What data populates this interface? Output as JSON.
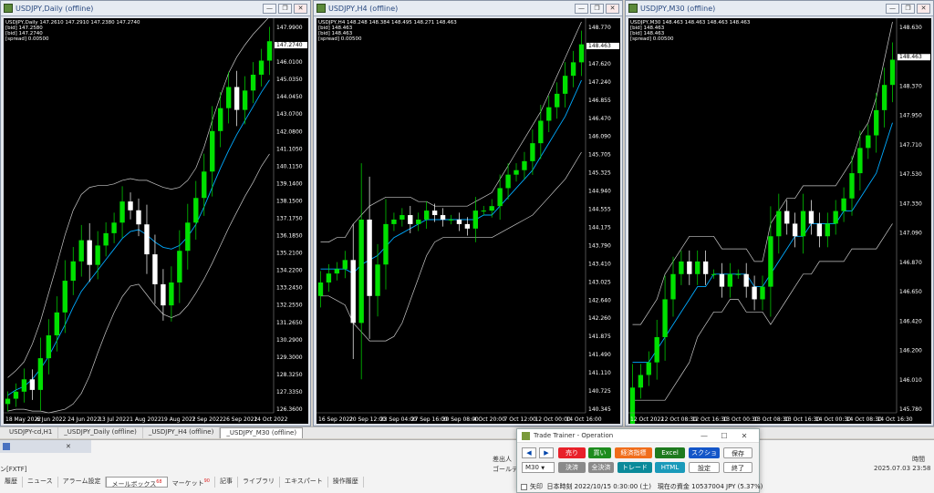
{
  "charts": [
    {
      "title": "USDJPY,Daily (offline)",
      "info1": "USDJPY,Daily  147.2610 147.2910 147.2380 147.2740",
      "info2": "[bid] 147.2580",
      "info3": "[bid] 147.2740",
      "info4": "[spread] 0.00500",
      "last_price": "147.2740",
      "yticks": [
        "147.9900",
        "147.2740",
        "146.0100",
        "145.0350",
        "144.0450",
        "143.0700",
        "142.0800",
        "141.1050",
        "140.1150",
        "139.1400",
        "138.1500",
        "137.1750",
        "136.1850",
        "135.2100",
        "134.2200",
        "133.2450",
        "132.2550",
        "131.2650",
        "130.2900",
        "129.3000",
        "128.3250",
        "127.3350",
        "126.3600"
      ],
      "xticks": [
        "18 May 2022",
        "6 Jun 2022",
        "24 Jun 2022",
        "13 Jul 2022",
        "1 Aug 2022",
        "19 Aug 2022",
        "7 Sep 2022",
        "26 Sep 2022",
        "14 Oct 2022"
      ],
      "series": {
        "close": [
          126.9,
          127.3,
          128.0,
          127.4,
          129.2,
          130.5,
          131.8,
          133.6,
          134.7,
          135.9,
          134.5,
          135.6,
          136.3,
          136.9,
          138.1,
          137.6,
          136.8,
          135.1,
          133.4,
          132.2,
          133.5,
          135.3,
          136.9,
          138.3,
          139.8,
          142.1,
          143.4,
          144.6,
          143.3,
          144.4,
          145.3,
          146.1,
          147.2
        ],
        "mid": [
          127.1,
          127.4,
          127.6,
          128.0,
          128.6,
          129.3,
          130.2,
          131.1,
          132.1,
          133.0,
          133.6,
          134.2,
          134.8,
          135.4,
          136.0,
          136.4,
          136.5,
          136.2,
          135.8,
          135.5,
          135.4,
          135.6,
          136.1,
          136.8,
          137.8,
          138.9,
          140.0,
          141.0,
          141.9,
          142.7,
          143.5,
          144.3,
          145.0
        ],
        "upper": [
          128.1,
          128.5,
          129.0,
          130.0,
          131.3,
          132.9,
          134.5,
          136.2,
          137.6,
          138.5,
          138.9,
          139.0,
          139.0,
          139.1,
          139.3,
          139.4,
          139.3,
          139.3,
          139.1,
          138.9,
          138.8,
          138.9,
          139.3,
          140.0,
          141.2,
          142.7,
          144.1,
          145.4,
          146.3,
          147.0,
          147.6,
          148.1,
          148.6
        ],
        "lower": [
          126.2,
          126.3,
          126.3,
          126.2,
          126.2,
          126.1,
          126.2,
          126.3,
          126.6,
          127.2,
          128.2,
          129.5,
          130.7,
          131.8,
          132.7,
          133.3,
          133.4,
          132.8,
          132.2,
          131.7,
          131.5,
          131.7,
          132.2,
          132.9,
          133.7,
          134.6,
          135.6,
          136.6,
          137.5,
          138.4,
          139.2,
          140.1,
          140.8
        ]
      },
      "ymin": 126.1,
      "ymax": 148.3
    },
    {
      "title": "USDJPY,H4 (offline)",
      "info1": "USDJPY,H4  148.248 148.384 148.495 148.271 148.463",
      "info2": "[bid] 148.463",
      "info3": "[bid] 148.463",
      "info4": "[spread] 0.00500",
      "last_price": "148.463",
      "yticks": [
        "148.770",
        "148.463",
        "147.620",
        "147.240",
        "146.855",
        "146.470",
        "146.090",
        "145.705",
        "145.325",
        "144.940",
        "144.555",
        "144.175",
        "143.790",
        "143.410",
        "143.025",
        "142.640",
        "142.260",
        "141.875",
        "141.490",
        "141.110",
        "140.725",
        "140.345"
      ],
      "xticks": [
        "16 Sep 2022",
        "20 Sep 12:00",
        "23 Sep 04:00",
        "27 Sep 16:00",
        "30 Sep 08:00",
        "4 Oct 20:00",
        "7 Oct 12:00",
        "12 Oct 00:00",
        "14 Oct 16:00"
      ],
      "series": {
        "close": [
          143.2,
          143.4,
          143.5,
          143.7,
          142.3,
          144.6,
          142.9,
          143.6,
          144.5,
          144.6,
          144.7,
          144.5,
          144.6,
          144.8,
          144.7,
          144.6,
          144.6,
          144.5,
          144.4,
          144.8,
          144.8,
          144.9,
          145.3,
          145.6,
          145.7,
          145.9,
          146.3,
          146.8,
          147.1,
          147.4,
          147.8,
          148.1,
          148.5
        ],
        "mid": [
          143.5,
          143.5,
          143.5,
          143.5,
          143.4,
          143.6,
          143.7,
          143.8,
          144.0,
          144.2,
          144.3,
          144.4,
          144.5,
          144.6,
          144.6,
          144.6,
          144.6,
          144.6,
          144.6,
          144.6,
          144.7,
          144.7,
          144.9,
          145.1,
          145.3,
          145.5,
          145.7,
          146.0,
          146.3,
          146.6,
          146.9,
          147.3,
          147.7
        ],
        "upper": [
          144.1,
          144.1,
          144.2,
          144.2,
          144.5,
          144.7,
          144.9,
          145.0,
          145.1,
          145.1,
          145.1,
          145.1,
          145.0,
          145.0,
          144.9,
          144.9,
          144.9,
          144.9,
          144.9,
          145.0,
          145.1,
          145.2,
          145.5,
          145.8,
          146.1,
          146.4,
          146.7,
          147.0,
          147.4,
          147.8,
          148.2,
          148.6,
          149.0
        ],
        "lower": [
          142.9,
          142.9,
          142.8,
          142.7,
          142.3,
          142.1,
          141.9,
          141.9,
          141.9,
          142.0,
          142.3,
          142.8,
          143.3,
          143.8,
          144.1,
          144.2,
          144.2,
          144.2,
          144.2,
          144.2,
          144.2,
          144.2,
          144.3,
          144.4,
          144.5,
          144.6,
          144.7,
          144.9,
          145.1,
          145.3,
          145.5,
          145.8,
          146.1
        ]
      },
      "ymin": 140.3,
      "ymax": 149.0
    },
    {
      "title": "USDJPY,M30 (offline)",
      "info1": "USDJPY,M30  148.463 148.463 148.463 148.463",
      "info2": "[bid] 148.463",
      "info3": "[bid] 148.463",
      "info4": "[spread] 0.00500",
      "last_price": "148.463",
      "yticks": [
        "148.630",
        "148.463",
        "148.370",
        "147.950",
        "147.710",
        "147.530",
        "147.330",
        "147.090",
        "146.870",
        "146.650",
        "146.420",
        "146.200",
        "146.010",
        "145.780"
      ],
      "xticks": [
        "12 Oct 2022",
        "12 Oct 08:30",
        "12 Oct 16:30",
        "13 Oct 00:30",
        "13 Oct 08:30",
        "13 Oct 16:30",
        "14 Oct 00:30",
        "14 Oct 08:30",
        "14 Oct 16:30"
      ],
      "series": {
        "close": [
          145.9,
          146.0,
          146.1,
          146.3,
          146.6,
          146.8,
          146.9,
          146.8,
          146.9,
          146.8,
          146.8,
          146.7,
          146.8,
          146.8,
          146.7,
          146.6,
          146.7,
          147.1,
          147.3,
          147.2,
          147.1,
          147.3,
          147.2,
          147.1,
          147.2,
          147.3,
          147.4,
          147.6,
          147.8,
          147.9,
          148.1,
          148.3,
          148.5
        ],
        "mid": [
          146.1,
          146.1,
          146.1,
          146.2,
          146.3,
          146.4,
          146.5,
          146.6,
          146.7,
          146.7,
          146.8,
          146.8,
          146.8,
          146.8,
          146.8,
          146.7,
          146.7,
          146.8,
          146.9,
          147.0,
          147.1,
          147.1,
          147.2,
          147.2,
          147.2,
          147.2,
          147.3,
          147.3,
          147.4,
          147.5,
          147.6,
          147.8,
          148.0
        ],
        "upper": [
          146.4,
          146.4,
          146.5,
          146.6,
          146.8,
          146.9,
          147.0,
          147.1,
          147.1,
          147.1,
          147.1,
          147.0,
          147.0,
          147.0,
          147.0,
          146.9,
          146.9,
          147.2,
          147.3,
          147.4,
          147.4,
          147.5,
          147.5,
          147.5,
          147.5,
          147.5,
          147.6,
          147.7,
          147.9,
          148.0,
          148.2,
          148.5,
          148.8
        ],
        "lower": [
          145.8,
          145.8,
          145.8,
          145.8,
          145.8,
          145.9,
          146.0,
          146.1,
          146.3,
          146.4,
          146.5,
          146.5,
          146.6,
          146.6,
          146.5,
          146.5,
          146.5,
          146.4,
          146.5,
          146.6,
          146.7,
          146.8,
          146.8,
          146.9,
          146.9,
          146.9,
          146.9,
          147.0,
          147.0,
          147.0,
          147.0,
          147.1,
          147.2
        ]
      },
      "ymin": 145.7,
      "ymax": 148.8
    }
  ],
  "tabs": [
    "USDJPY-cd,H1",
    "_USDJPY_Daily (offline)",
    "_USDJPY_H4 (offline)",
    "_USDJPY_M30 (offline)"
  ],
  "terminal": {
    "col_issuer": "差出人",
    "issuer_value": "ゴールデン",
    "col_time": "時間",
    "time_value": "2025.07.03 23:58",
    "left_label": "ン[FXTF]",
    "tabs": [
      "履歴",
      "ニュース",
      "アラーム設定",
      "メールボックス",
      "マーケット",
      "記事",
      "ライブラリ",
      "エキスパート",
      "操作履歴"
    ],
    "mail_badge": "68",
    "market_badge": "90"
  },
  "dialog": {
    "title": "Trade Trainer - Operation",
    "timeframe": "M30",
    "buttons": {
      "sell": "売り",
      "buy": "買い",
      "settle_indicator": "経済指標",
      "excel": "Excel",
      "screenshot": "スクショ",
      "save": "保存",
      "settle": "決済",
      "settle_all": "全決済",
      "trade": "トレード",
      "html": "HTML",
      "settings": "設定",
      "exit": "終了"
    },
    "arrow_label": "矢印",
    "status": "日本時刻 2022/10/15 0:30:00 (土)　現在の資金 10537004 JPY (5.37%)"
  },
  "colors": {
    "bull": "#00e000",
    "bear": "#ffffff",
    "ma": "#00aaff",
    "band": "#c8c8c8",
    "sell": "#e8212a",
    "buy": "#1e8c1e",
    "econ": "#f06d1b",
    "excel": "#1e7a1e",
    "shot": "#1456c8",
    "trade": "#0b8a9a",
    "html": "#1a9aba",
    "gray": "#8a8a8a"
  }
}
